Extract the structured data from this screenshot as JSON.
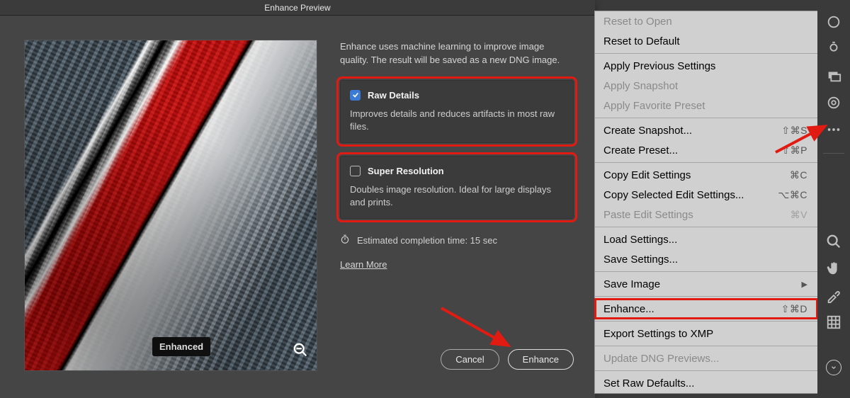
{
  "dialog": {
    "title": "Enhance Preview",
    "description": "Enhance uses machine learning to improve image quality. The result will be saved as a new DNG image.",
    "raw_details": {
      "title": "Raw Details",
      "checked": true,
      "desc": "Improves details and reduces artifacts in most raw files."
    },
    "super_res": {
      "title": "Super Resolution",
      "checked": false,
      "desc": "Doubles image resolution. Ideal for large displays and prints."
    },
    "eta": "Estimated completion time: 15 sec",
    "learn_more": "Learn More",
    "cancel": "Cancel",
    "enhance": "Enhance",
    "badge": "Enhanced"
  },
  "menu": {
    "reset_open": "Reset to Open",
    "reset_default": "Reset to Default",
    "apply_prev": "Apply Previous Settings",
    "apply_snap": "Apply Snapshot",
    "apply_fav": "Apply Favorite Preset",
    "create_snap": "Create Snapshot...",
    "create_snap_sc": "⇧⌘S",
    "create_preset": "Create Preset...",
    "create_preset_sc": "⇧⌘P",
    "copy_edit": "Copy Edit Settings",
    "copy_edit_sc": "⌘C",
    "copy_sel": "Copy Selected Edit Settings...",
    "copy_sel_sc": "⌥⌘C",
    "paste": "Paste Edit Settings",
    "paste_sc": "⌘V",
    "load": "Load Settings...",
    "save": "Save Settings...",
    "save_img": "Save Image",
    "enhance": "Enhance...",
    "enhance_sc": "⇧⌘D",
    "export_xmp": "Export Settings to XMP",
    "update_dng": "Update DNG Previews...",
    "raw_defaults": "Set Raw Defaults..."
  }
}
